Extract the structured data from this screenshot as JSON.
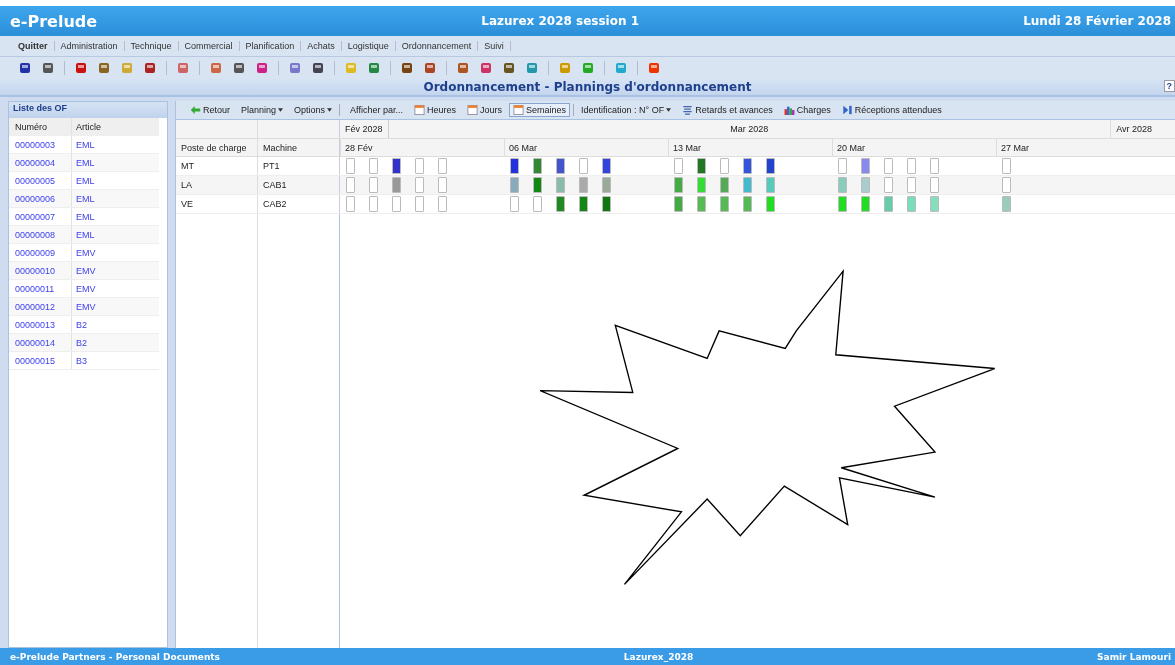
{
  "header": {
    "app": "e-Prelude",
    "session": "Lazurex 2028 session 1",
    "date": "Lundi 28 Février 2028"
  },
  "menu": [
    {
      "label": "Quitter",
      "selected": true
    },
    {
      "label": "Administration",
      "selected": false
    },
    {
      "label": "Technique",
      "selected": false
    },
    {
      "label": "Commercial",
      "selected": false
    },
    {
      "label": "Planification",
      "selected": false
    },
    {
      "label": "Achats",
      "selected": false
    },
    {
      "label": "Logistique",
      "selected": false
    },
    {
      "label": "Ordonnancement",
      "selected": false
    },
    {
      "label": "Suivi",
      "selected": false
    }
  ],
  "page_title": "Ordonnancement - Plannings d'ordonnancement",
  "help": "?",
  "of_list": {
    "title": "Liste des OF",
    "columns": [
      "Numéro",
      "Article"
    ],
    "rows": [
      [
        "00000003",
        "EML"
      ],
      [
        "00000004",
        "EML"
      ],
      [
        "00000005",
        "EML"
      ],
      [
        "00000006",
        "EML"
      ],
      [
        "00000007",
        "EML"
      ],
      [
        "00000008",
        "EML"
      ],
      [
        "00000009",
        "EMV"
      ],
      [
        "00000010",
        "EMV"
      ],
      [
        "00000011",
        "EMV"
      ],
      [
        "00000012",
        "EMV"
      ],
      [
        "00000013",
        "B2"
      ],
      [
        "00000014",
        "B2"
      ],
      [
        "00000015",
        "B3"
      ]
    ]
  },
  "actions": {
    "back": "Retour",
    "planning": "Planning",
    "options": "Options",
    "show_by": "Afficher par...",
    "views": [
      {
        "label": "Heures",
        "selected": false
      },
      {
        "label": "Jours",
        "selected": false
      },
      {
        "label": "Semaines",
        "selected": true
      }
    ],
    "identification": "Identification : N° OF",
    "delays": "Retards et avances",
    "loads": "Charges",
    "receptions": "Réceptions attendues"
  },
  "gantt": {
    "columns": [
      "Poste de charge",
      "Machine"
    ],
    "months": [
      "Fév 2028",
      "Mar 2028",
      "Avr 2028"
    ],
    "weeks": [
      "28 Fév",
      "06 Mar",
      "13 Mar",
      "20 Mar",
      "27 Mar"
    ],
    "rows": [
      {
        "poste": "MT",
        "machine": "PT1",
        "days": [
          {
            "filled": false
          },
          {
            "filled": false
          },
          {
            "filled": true,
            "color": "#3333cc"
          },
          {
            "filled": false
          },
          {
            "filled": false
          },
          {
            "filled": true,
            "color": "#2233dd"
          },
          {
            "filled": true,
            "color": "#338833"
          },
          {
            "filled": true,
            "color": "#4455cc"
          },
          {
            "filled": false
          },
          {
            "filled": true,
            "color": "#3344dd"
          },
          {
            "filled": false
          },
          {
            "filled": true,
            "color": "#227722"
          },
          {
            "filled": false
          },
          {
            "filled": true,
            "color": "#3355dd"
          },
          {
            "filled": true,
            "color": "#2244cc"
          },
          {
            "filled": false
          },
          {
            "filled": true,
            "color": "#8888ee"
          },
          {
            "filled": false
          },
          {
            "filled": false
          },
          {
            "filled": false
          },
          {
            "filled": false
          }
        ]
      },
      {
        "poste": "LA",
        "machine": "CAB1",
        "days": [
          {
            "filled": false
          },
          {
            "filled": false
          },
          {
            "filled": true,
            "color": "#999999"
          },
          {
            "filled": false
          },
          {
            "filled": false
          },
          {
            "filled": true,
            "color": "#88aabb"
          },
          {
            "filled": true,
            "color": "#118811"
          },
          {
            "filled": true,
            "color": "#88bbaa"
          },
          {
            "filled": true,
            "color": "#aaaaaa"
          },
          {
            "filled": true,
            "color": "#99aa99"
          },
          {
            "filled": true,
            "color": "#44aa44"
          },
          {
            "filled": true,
            "color": "#33dd33"
          },
          {
            "filled": true,
            "color": "#55aa55"
          },
          {
            "filled": true,
            "color": "#44bbcc"
          },
          {
            "filled": true,
            "color": "#55ccbb"
          },
          {
            "filled": true,
            "color": "#88ccbb"
          },
          {
            "filled": true,
            "color": "#aacccc"
          },
          {
            "filled": false
          },
          {
            "filled": false
          },
          {
            "filled": false
          },
          {
            "filled": false
          }
        ]
      },
      {
        "poste": "VE",
        "machine": "CAB2",
        "days": [
          {
            "filled": false
          },
          {
            "filled": false
          },
          {
            "filled": false
          },
          {
            "filled": false
          },
          {
            "filled": false
          },
          {
            "filled": false
          },
          {
            "filled": false
          },
          {
            "filled": true,
            "color": "#228822"
          },
          {
            "filled": true,
            "color": "#118811"
          },
          {
            "filled": true,
            "color": "#117711"
          },
          {
            "filled": true,
            "color": "#44aa44"
          },
          {
            "filled": true,
            "color": "#55bb55"
          },
          {
            "filled": true,
            "color": "#55bb55"
          },
          {
            "filled": true,
            "color": "#55bb55"
          },
          {
            "filled": true,
            "color": "#22dd22"
          },
          {
            "filled": true,
            "color": "#22dd22"
          },
          {
            "filled": true,
            "color": "#22dd22"
          },
          {
            "filled": true,
            "color": "#66ccaa"
          },
          {
            "filled": true,
            "color": "#77ddbb"
          },
          {
            "filled": true,
            "color": "#88ddbb"
          },
          {
            "filled": true,
            "color": "#99ccbb"
          }
        ]
      }
    ]
  },
  "footer": {
    "left": "e-Prelude Partners - Personal Documents",
    "center": "Lazurex_2028",
    "right": "Samir Lamouri"
  }
}
